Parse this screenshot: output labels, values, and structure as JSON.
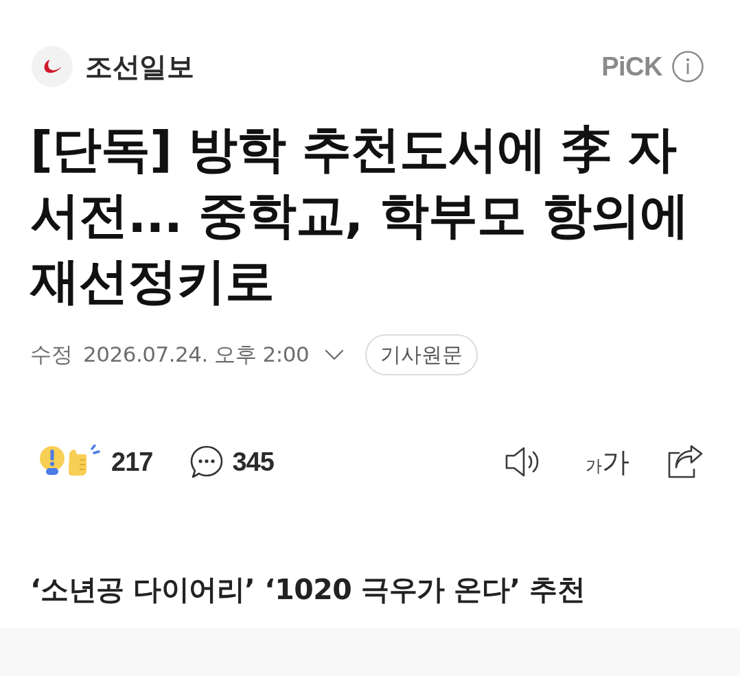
{
  "header": {
    "press_name": "조선일보",
    "pick_label": "PiCK"
  },
  "headline": "[단독] 방학 추천도서에 李 자서전... 중학교, 학부모 항의에 재선정키로",
  "meta": {
    "label": "수정",
    "datetime": "2026.07.24. 오후 2:00",
    "original_button": "기사원문"
  },
  "reactions": {
    "reaction_count": "217",
    "comment_count": "345"
  },
  "toolbar": {
    "font_size_small": "가",
    "font_size_large": "가"
  },
  "subtitle": "‘소년공 다이어리’ ‘1020 극우가 온다’ 추천"
}
